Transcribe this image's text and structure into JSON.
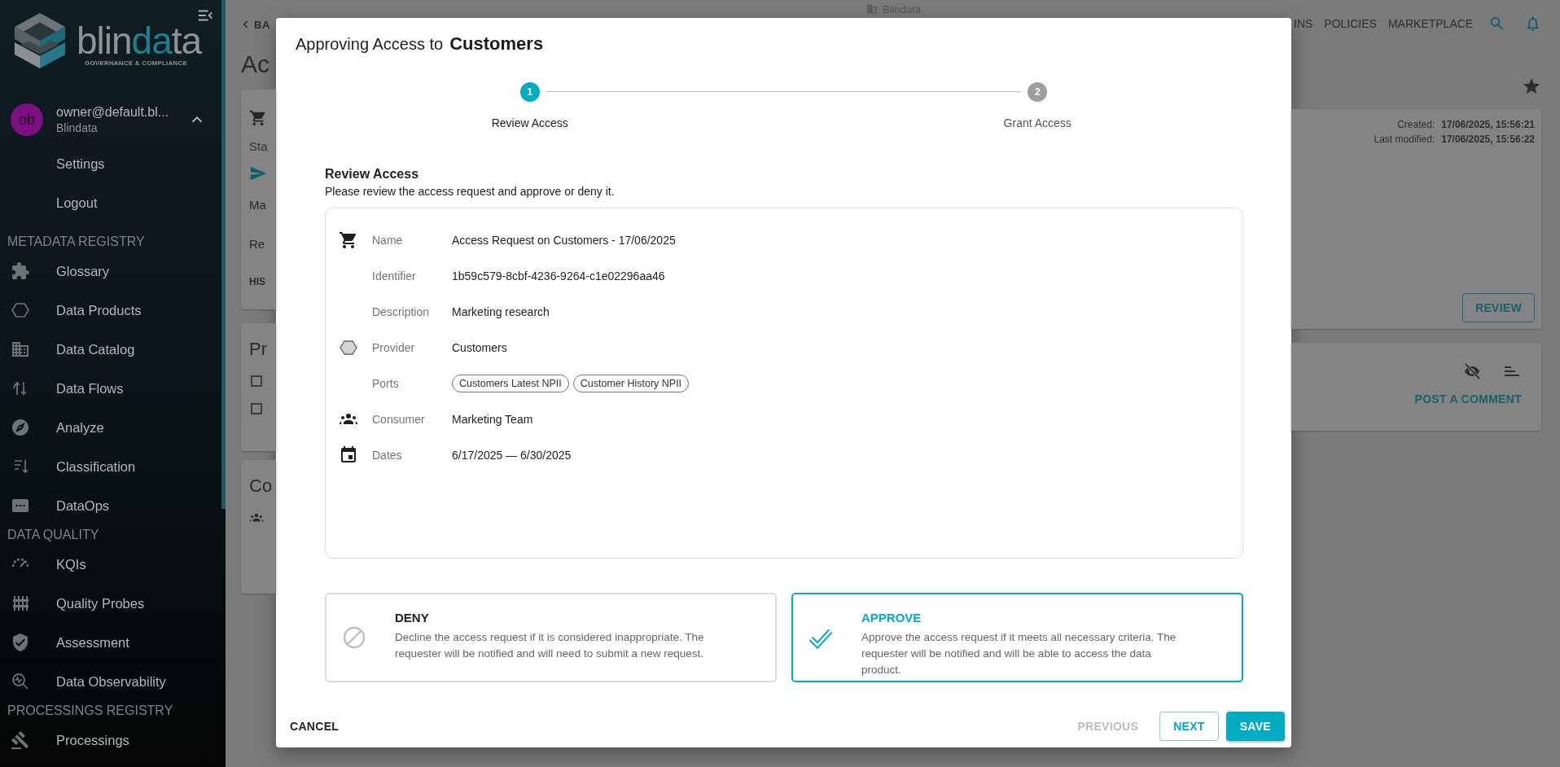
{
  "sidebar": {
    "logo": [
      {
        "text": "blin",
        "accent": false
      },
      {
        "text": "da",
        "accent": true
      },
      {
        "text": "ta",
        "accent": false
      }
    ],
    "logo_tagline": "GOVERNANCE & COMPLIANCE",
    "user": {
      "avatar": "ob",
      "email": "owner@default.bl...",
      "organization": "Blindata",
      "expanded": true
    },
    "user_menu": [
      "Settings",
      "Logout"
    ],
    "sections": [
      {
        "title": "METADATA REGISTRY",
        "items": [
          "Glossary",
          "Data Products",
          "Data Catalog",
          "Data Flows",
          "Analyze",
          "Classification",
          "DataOps"
        ]
      },
      {
        "title": "DATA QUALITY",
        "items": [
          "KQIs",
          "Quality Probes",
          "Assessment",
          "Data Observability"
        ]
      },
      {
        "title": "PROCESSINGS REGISTRY",
        "items": [
          "Processings"
        ]
      }
    ]
  },
  "top_bar": {
    "app_name": "Blindata",
    "nav": [
      "INS",
      "POLICIES",
      "MARKETPLACE"
    ]
  },
  "page": {
    "back_link": "BA",
    "title": "Ac",
    "request_card": {
      "fragments": [
        "Sta",
        "Ma",
        "Re"
      ],
      "tab": "HIS",
      "created_label": "Created:",
      "created": "17/06/2025, 15:56:21",
      "modified_label": "Last modified:",
      "modified": "17/06/2025, 15:56:22",
      "review_button": "REVIEW"
    },
    "second_card": {
      "title": "Pr"
    },
    "comments_card": {
      "post_button": "POST A COMMENT"
    },
    "third_card": {
      "title": "Co"
    }
  },
  "dialog": {
    "title_prefix": "Approving Access to",
    "title_subject": "Customers",
    "steps": [
      {
        "number": "1",
        "label": "Review Access",
        "selected": true
      },
      {
        "number": "2",
        "label": "Grant Access",
        "selected": false
      }
    ],
    "section_title": "Review Access",
    "section_subtitle": "Please review the access request and approve or deny it.",
    "details": [
      {
        "label": "Name",
        "kind": "text",
        "value": "Access Request on Customers - 17/06/2025"
      },
      {
        "label": "Identifier",
        "kind": "text",
        "value": "1b59c579-8cbf-4236-9264-c1e02296aa46"
      },
      {
        "label": "Description",
        "kind": "text",
        "value": "Marketing research"
      },
      {
        "label": "Provider",
        "kind": "text",
        "value": "Customers"
      },
      {
        "label": "Ports",
        "kind": "chips",
        "values": [
          "Customers Latest NPII",
          "Customer History NPII"
        ]
      },
      {
        "label": "Consumer",
        "kind": "text",
        "value": "Marketing Team"
      },
      {
        "label": "Dates",
        "kind": "text",
        "value": "6/17/2025 — 6/30/2025"
      }
    ],
    "decisions": [
      {
        "title": "DENY",
        "description": "Decline the access request if it is considered inappropriate. The requester will be notified and will need to submit a new request.",
        "selected": false
      },
      {
        "title": "APPROVE",
        "description": "Approve the access request if it meets all necessary criteria. The requester will be notified and will be able to access the data product.",
        "selected": true
      }
    ],
    "cancel_button": "CANCEL",
    "nav_buttons": [
      {
        "label": "PREVIOUS",
        "kind": "text",
        "disabled": true
      },
      {
        "label": "NEXT",
        "kind": "outlined",
        "disabled": false
      },
      {
        "label": "SAVE",
        "kind": "filled",
        "disabled": false
      }
    ]
  }
}
